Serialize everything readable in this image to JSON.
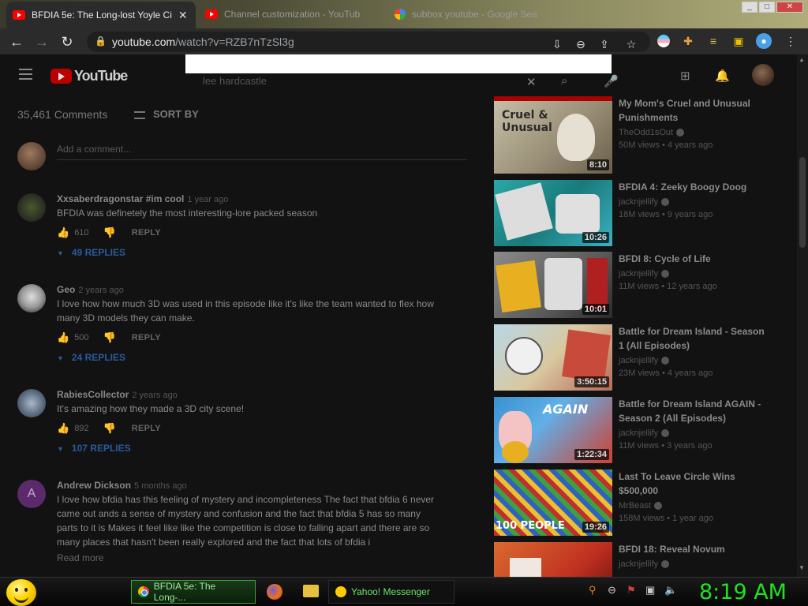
{
  "browser": {
    "tabs": [
      {
        "title": "BFDIA 5e: The Long-lost Yoyle Ci",
        "favicon": "youtube-icon",
        "active": true
      },
      {
        "title": "Channel customization - YouTub",
        "favicon": "youtube-icon",
        "active": false
      },
      {
        "title": "subbox youtube - Google Sea",
        "favicon": "google-icon",
        "active": false
      }
    ],
    "url_host": "youtube.com",
    "url_path": "/watch?v=RZB7nTzSl3g"
  },
  "youtube": {
    "logo_text": "YouTube",
    "search_query": "lee hardcastle"
  },
  "comments": {
    "count_label": "35,461 Comments",
    "sort_label": "SORT BY",
    "add_placeholder": "Add a comment...",
    "reply_label": "REPLY",
    "read_more": "Read more",
    "items": [
      {
        "author": "Xxsaberdragonstar #im cool",
        "time": "1 year ago",
        "text": "BFDIA was definetely the most interesting-lore packed season",
        "likes": "610",
        "replies": "49 REPLIES"
      },
      {
        "author": "Geo",
        "time": "2 years ago",
        "text": "I love how how much 3D was used in this episode like it's like the team wanted to flex how many 3D models they can make.",
        "likes": "500",
        "replies": "24 REPLIES"
      },
      {
        "author": "RabiesCollector",
        "time": "2 years ago",
        "text": "It's amazing how they made a 3D city scene!",
        "likes": "892",
        "replies": "107 REPLIES"
      },
      {
        "author": "Andrew Dickson",
        "time": "5 months ago",
        "initial": "A",
        "text": "I love how bfdia has this feeling of mystery and incompleteness The fact that bfdia 6 never came out ands a sense of mystery and confusion and the fact that bfdia 5 has so many parts to it is Makes it feel like like the competition is close to falling apart and there are so many places that hasn't been really explored and the fact that lots of bfdia i"
      }
    ]
  },
  "recommendations": [
    {
      "title": "My Mom's Cruel and Unusual Punishments",
      "channel": "TheOdd1sOut",
      "meta": "50M views • 4 years ago",
      "duration": "8:10",
      "thumb_text": "Cruel & Unusual"
    },
    {
      "title": "BFDIA 4: Zeeky Boogy Doog",
      "channel": "jacknjellify",
      "meta": "18M views • 9 years ago",
      "duration": "10:26"
    },
    {
      "title": "BFDI 8: Cycle of Life",
      "channel": "jacknjellify",
      "meta": "11M views • 12 years ago",
      "duration": "10:01"
    },
    {
      "title": "Battle for Dream Island - Season 1 (All Episodes)",
      "channel": "jacknjellify",
      "meta": "23M views • 4 years ago",
      "duration": "3:50:15"
    },
    {
      "title": "Battle for Dream Island AGAIN - Season 2 (All Episodes)",
      "channel": "jacknjellify",
      "meta": "11M views • 3 years ago",
      "duration": "1:22:34",
      "thumb_text": "AGAIN"
    },
    {
      "title": "Last To Leave Circle Wins $500,000",
      "channel": "MrBeast",
      "meta": "158M views • 1 year ago",
      "duration": "19:26",
      "thumb_text": "100 PEOPLE"
    },
    {
      "title": "BFDI 18: Reveal Novum",
      "channel": "jacknjellify",
      "meta": "",
      "duration": ""
    }
  ],
  "taskbar": {
    "items": [
      {
        "label": "BFDIA 5e: The Long-..."
      },
      {
        "label": "Yahoo! Messenger"
      }
    ],
    "clock": "8:19 AM"
  },
  "colors": {
    "accent_red": "#ff0000",
    "clock_green": "#22e022",
    "replies_blue": "#2a5a9a"
  }
}
